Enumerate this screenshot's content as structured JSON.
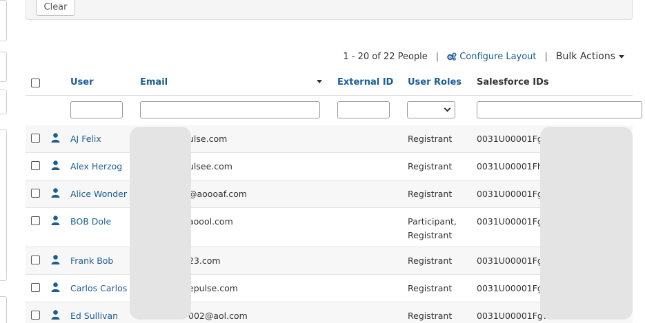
{
  "filter_panel": {
    "clear_label": "Clear"
  },
  "toolbar": {
    "count_text": "1 - 20 of 22 People",
    "separator": "|",
    "configure_label": "Configure Layout",
    "bulk_label": "Bulk Actions"
  },
  "table": {
    "headers": {
      "user": "User",
      "email": "Email",
      "external_id": "External ID",
      "user_roles": "User Roles",
      "salesforce_ids": "Salesforce IDs"
    },
    "rows": [
      {
        "name": "AJ Felix",
        "email": "ulse.com",
        "roles": "Registrant",
        "sfid": "0031U00001Fgz"
      },
      {
        "name": "Alex Herzog",
        "email": "ulsee.com",
        "roles": "Registrant",
        "sfid": "0031U00001Fh8"
      },
      {
        "name": "Alice Wonder",
        "email": "@aoooaf.com",
        "roles": "Registrant",
        "sfid": "0031U00001Fgz"
      },
      {
        "name": "BOB Dole",
        "email": "aoool.com",
        "roles": "Participant,",
        "roles2": "Registrant",
        "sfid": "0031U00001Fgz"
      },
      {
        "name": "Frank Bob",
        "email": "23.com",
        "roles": "Registrant",
        "sfid": "0031U00001Fgw"
      },
      {
        "name": "Carlos Carlos",
        "email": "epulse.com",
        "roles": "Registrant",
        "sfid": "0031U00001Fgz"
      },
      {
        "name": "Ed Sullivan",
        "email": "002@aol.com",
        "roles": "Registrant",
        "sfid": "0031U00001Fgw"
      }
    ]
  },
  "colors": {
    "link": "#1a5c96",
    "text": "#333333",
    "row_alt": "#f7f7f7",
    "redaction": "#e4e4e4"
  },
  "icons": {
    "configure": "gears-icon",
    "person": "person-icon",
    "dropdown": "caret-down-icon"
  }
}
